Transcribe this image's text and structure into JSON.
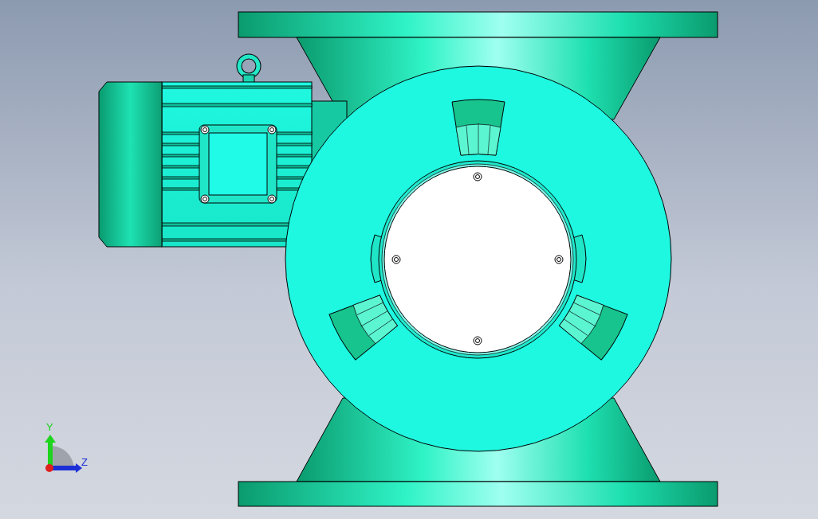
{
  "viewport": {
    "triad": {
      "axes": [
        {
          "label": "Y"
        },
        {
          "label": "Z"
        }
      ]
    }
  }
}
